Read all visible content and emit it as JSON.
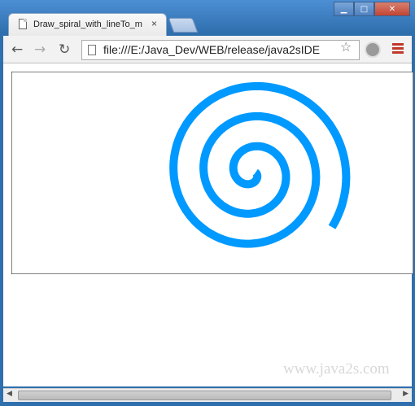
{
  "window": {
    "tab_title": "Draw_spiral_with_lineTo_m",
    "tab_close": "×",
    "min_glyph": "▁",
    "max_glyph": "□",
    "close_glyph": "✕"
  },
  "toolbar": {
    "back": "←",
    "forward": "→",
    "reload": "↻",
    "url": "file:///E:/Java_Dev/WEB/release/java2sIDE",
    "star": "☆"
  },
  "content": {
    "watermark": "www.java2s.com",
    "spiral_color": "#0099ff"
  },
  "scrollbar": {
    "left_arrow": "◀",
    "right_arrow": "▶"
  }
}
